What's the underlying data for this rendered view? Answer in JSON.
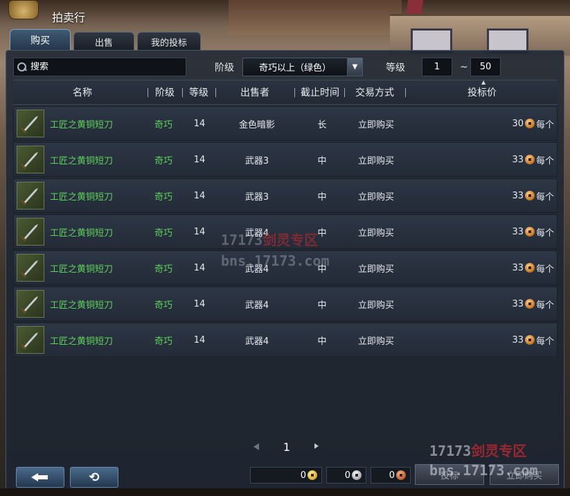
{
  "window": {
    "title": "拍卖行"
  },
  "tabs": [
    {
      "label": "购买",
      "active": true
    },
    {
      "label": "出售",
      "active": false
    },
    {
      "label": "我的投标",
      "active": false
    }
  ],
  "filters": {
    "search_placeholder": "搜索",
    "grade_label": "阶级",
    "grade_value": "奇巧以上（绿色）",
    "level_label": "等级",
    "level_min": "1",
    "level_sep": "~",
    "level_max": "50"
  },
  "columns": {
    "name": "名称",
    "grade": "阶级",
    "level": "等级",
    "seller": "出售者",
    "time": "截止时间",
    "trade": "交易方式",
    "price": "投标价"
  },
  "rows": [
    {
      "name": "工匠之黄铜短刀",
      "grade": "奇巧",
      "level": "14",
      "seller": "金色暗影",
      "time": "长",
      "trade": "立即购买",
      "price": "30",
      "unit": "每个"
    },
    {
      "name": "工匠之黄铜短刀",
      "grade": "奇巧",
      "level": "14",
      "seller": "武器3",
      "time": "中",
      "trade": "立即购买",
      "price": "33",
      "unit": "每个"
    },
    {
      "name": "工匠之黄铜短刀",
      "grade": "奇巧",
      "level": "14",
      "seller": "武器3",
      "time": "中",
      "trade": "立即购买",
      "price": "33",
      "unit": "每个"
    },
    {
      "name": "工匠之黄铜短刀",
      "grade": "奇巧",
      "level": "14",
      "seller": "武器4",
      "time": "中",
      "trade": "立即购买",
      "price": "33",
      "unit": "每个"
    },
    {
      "name": "工匠之黄铜短刀",
      "grade": "奇巧",
      "level": "14",
      "seller": "武器4",
      "time": "中",
      "trade": "立即购买",
      "price": "33",
      "unit": "每个"
    },
    {
      "name": "工匠之黄铜短刀",
      "grade": "奇巧",
      "level": "14",
      "seller": "武器4",
      "time": "中",
      "trade": "立即购买",
      "price": "33",
      "unit": "每个"
    },
    {
      "name": "工匠之黄铜短刀",
      "grade": "奇巧",
      "level": "14",
      "seller": "武器4",
      "time": "中",
      "trade": "立即购买",
      "price": "33",
      "unit": "每个"
    }
  ],
  "pagination": {
    "page": "1"
  },
  "money": {
    "gold": "0",
    "silver": "0",
    "copper": "0"
  },
  "actions": {
    "bid": "投标",
    "buy_now": "立即购买"
  },
  "watermark": {
    "line1": "17173",
    "line1_cn": "剑灵专区",
    "line2": "bns.17173.com"
  },
  "icons": {
    "back": "arrow-left-icon",
    "refresh": "refresh-icon",
    "search": "search-icon",
    "coin": "coin-icon",
    "item": "dagger-icon"
  },
  "colors": {
    "item_green": "#5fd25a",
    "accent_blue": "#4a6a8c"
  }
}
